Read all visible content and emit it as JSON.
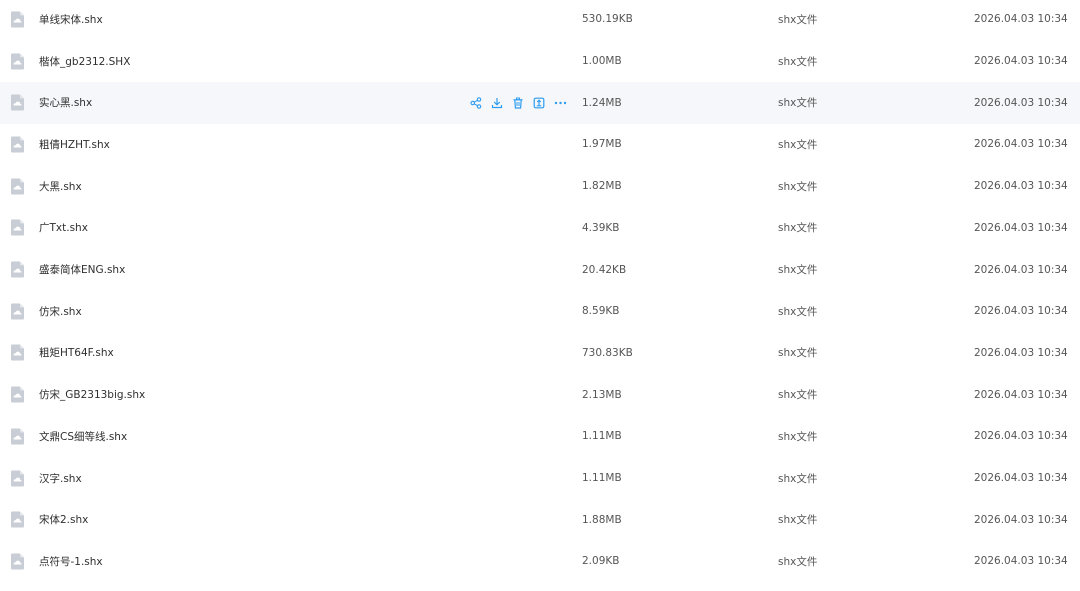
{
  "files": [
    {
      "name": "单线宋体.shx",
      "size": "530.19KB",
      "type": "shx文件",
      "date": "2026.04.03 10:34"
    },
    {
      "name": "楷体_gb2312.SHX",
      "size": "1.00MB",
      "type": "shx文件",
      "date": "2026.04.03 10:34"
    },
    {
      "name": "实心黑.shx",
      "size": "1.24MB",
      "type": "shx文件",
      "date": "2026.04.03 10:34"
    },
    {
      "name": "粗倩HZHT.shx",
      "size": "1.97MB",
      "type": "shx文件",
      "date": "2026.04.03 10:34"
    },
    {
      "name": "大黑.shx",
      "size": "1.82MB",
      "type": "shx文件",
      "date": "2026.04.03 10:34"
    },
    {
      "name": "广Txt.shx",
      "size": "4.39KB",
      "type": "shx文件",
      "date": "2026.04.03 10:34"
    },
    {
      "name": "盛泰简体ENG.shx",
      "size": "20.42KB",
      "type": "shx文件",
      "date": "2026.04.03 10:34"
    },
    {
      "name": "仿宋.shx",
      "size": "8.59KB",
      "type": "shx文件",
      "date": "2026.04.03 10:34"
    },
    {
      "name": "粗矩HT64F.shx",
      "size": "730.83KB",
      "type": "shx文件",
      "date": "2026.04.03 10:34"
    },
    {
      "name": "仿宋_GB2313big.shx",
      "size": "2.13MB",
      "type": "shx文件",
      "date": "2026.04.03 10:34"
    },
    {
      "name": "文鼎CS细等线.shx",
      "size": "1.11MB",
      "type": "shx文件",
      "date": "2026.04.03 10:34"
    },
    {
      "name": "汉字.shx",
      "size": "1.11MB",
      "type": "shx文件",
      "date": "2026.04.03 10:34"
    },
    {
      "name": "宋体2.shx",
      "size": "1.88MB",
      "type": "shx文件",
      "date": "2026.04.03 10:34"
    },
    {
      "name": "点符号-1.shx",
      "size": "2.09KB",
      "type": "shx文件",
      "date": "2026.04.03 10:34"
    }
  ],
  "hovered_row": 2,
  "row_actions": [
    {
      "icon": "share-icon"
    },
    {
      "icon": "download-icon"
    },
    {
      "icon": "delete-icon"
    },
    {
      "icon": "move-icon"
    },
    {
      "icon": "more-icon"
    }
  ],
  "colors": {
    "accent": "#2d9cf0",
    "icon_fill": "#c9ced6",
    "hover_bg": "#f5f7fa"
  }
}
